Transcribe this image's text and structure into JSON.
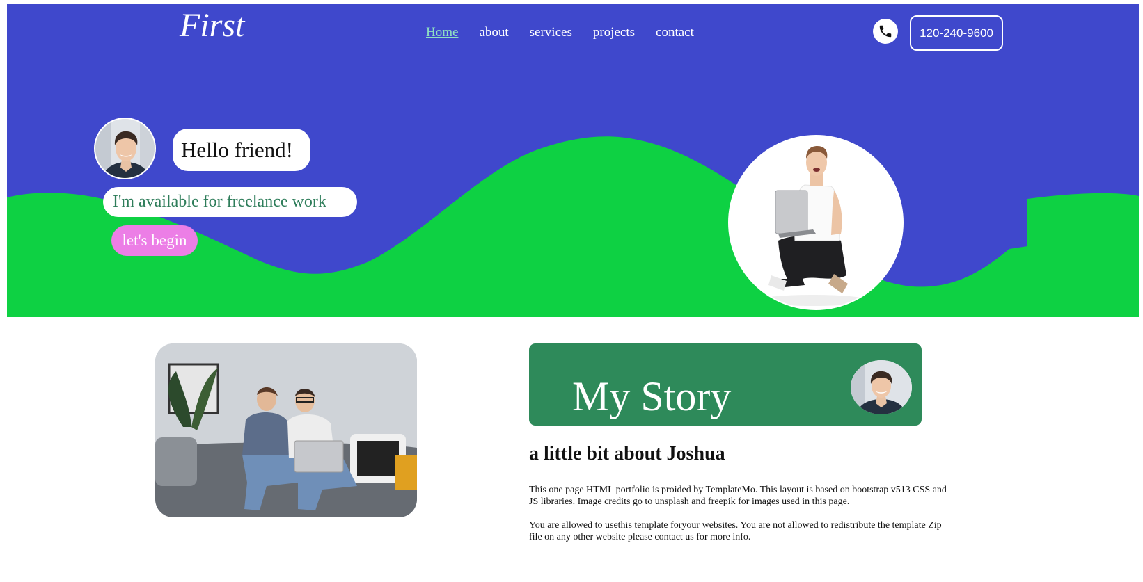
{
  "header": {
    "logo": "First",
    "nav": [
      "Home",
      "about",
      "services",
      "projects",
      "contact"
    ],
    "phone": "120-240-9600"
  },
  "hero": {
    "greeting": "Hello friend!",
    "tagline": "I'm available for freelance work",
    "cta": "let's begin"
  },
  "about": {
    "card_title": "My Story",
    "heading": "a little bit about Joshua",
    "paragraphs": [
      "This one page HTML portfolio is proided by TemplateMo. This layout is based on bootstrap v513 CSS and JS libraries. Image credits go to unsplash and freepik for images used in this page.",
      "You are allowed to usethis template foryour websites. You are not allowed to redistribute the template Zip file on any other website please contact us for more info."
    ]
  },
  "colors": {
    "hero_background": "#3f48cc",
    "wave": "#0ed143",
    "nav_active": "#8fe0c2",
    "cta_button": "#ec7ee6",
    "story_card": "#2e8a5a",
    "tagline_text": "#2e7d5a"
  },
  "icons": {
    "phone": "phone-icon"
  }
}
